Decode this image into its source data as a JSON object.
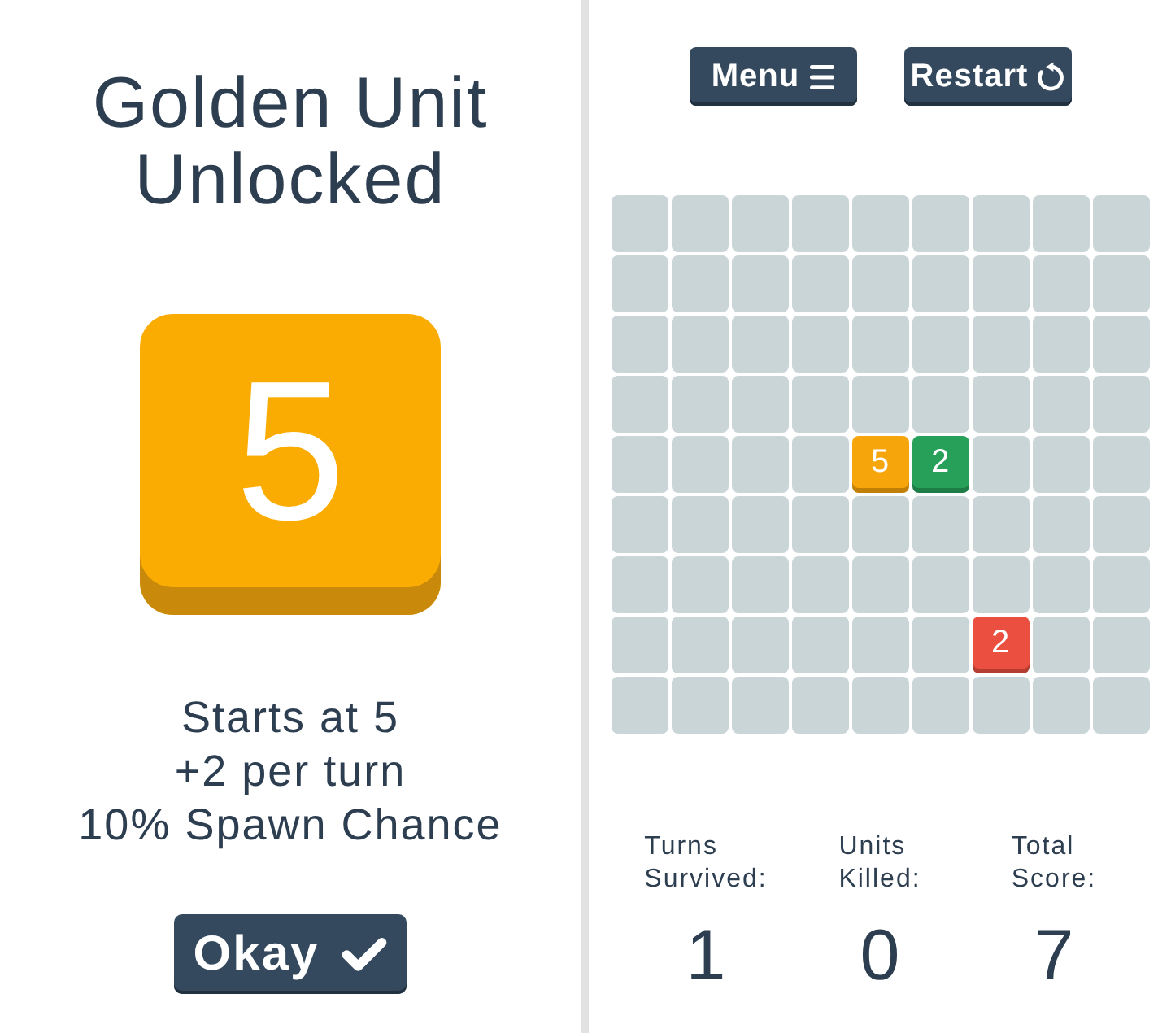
{
  "left_panel": {
    "title": "Golden Unit Unlocked",
    "unit_tile": {
      "value": "5"
    },
    "description_lines": [
      "Starts at 5",
      "+2 per turn",
      "10% Spawn Chance"
    ],
    "okay_button": {
      "label": "Okay"
    }
  },
  "right_panel": {
    "toolbar": [
      {
        "label": "Menu",
        "kind": "menu"
      },
      {
        "label": "Restart",
        "kind": "restart"
      }
    ],
    "board": {
      "rows": [
        [
          null,
          null,
          null,
          null,
          null,
          null,
          null,
          null,
          null
        ],
        [
          null,
          null,
          null,
          null,
          null,
          null,
          null,
          null,
          null
        ],
        [
          null,
          null,
          null,
          null,
          null,
          null,
          null,
          null,
          null
        ],
        [
          null,
          null,
          null,
          null,
          null,
          null,
          null,
          null,
          null
        ],
        [
          null,
          null,
          null,
          null,
          {
            "value": "5",
            "color": "#f6a50a"
          },
          {
            "value": "2",
            "color": "#27a15a"
          },
          null,
          null,
          null
        ],
        [
          null,
          null,
          null,
          null,
          null,
          null,
          null,
          null,
          null
        ],
        [
          null,
          null,
          null,
          null,
          null,
          null,
          null,
          null,
          null
        ],
        [
          null,
          null,
          null,
          null,
          null,
          null,
          {
            "value": "2",
            "color": "#ea4f3f"
          },
          null,
          null
        ],
        [
          null,
          null,
          null,
          null,
          null,
          null,
          null,
          null,
          null
        ]
      ]
    },
    "stats": [
      {
        "label": "Turns Survived:",
        "value": "1"
      },
      {
        "label": "Units Killed:",
        "value": "0"
      },
      {
        "label": "Total Score:",
        "value": "7"
      }
    ]
  }
}
